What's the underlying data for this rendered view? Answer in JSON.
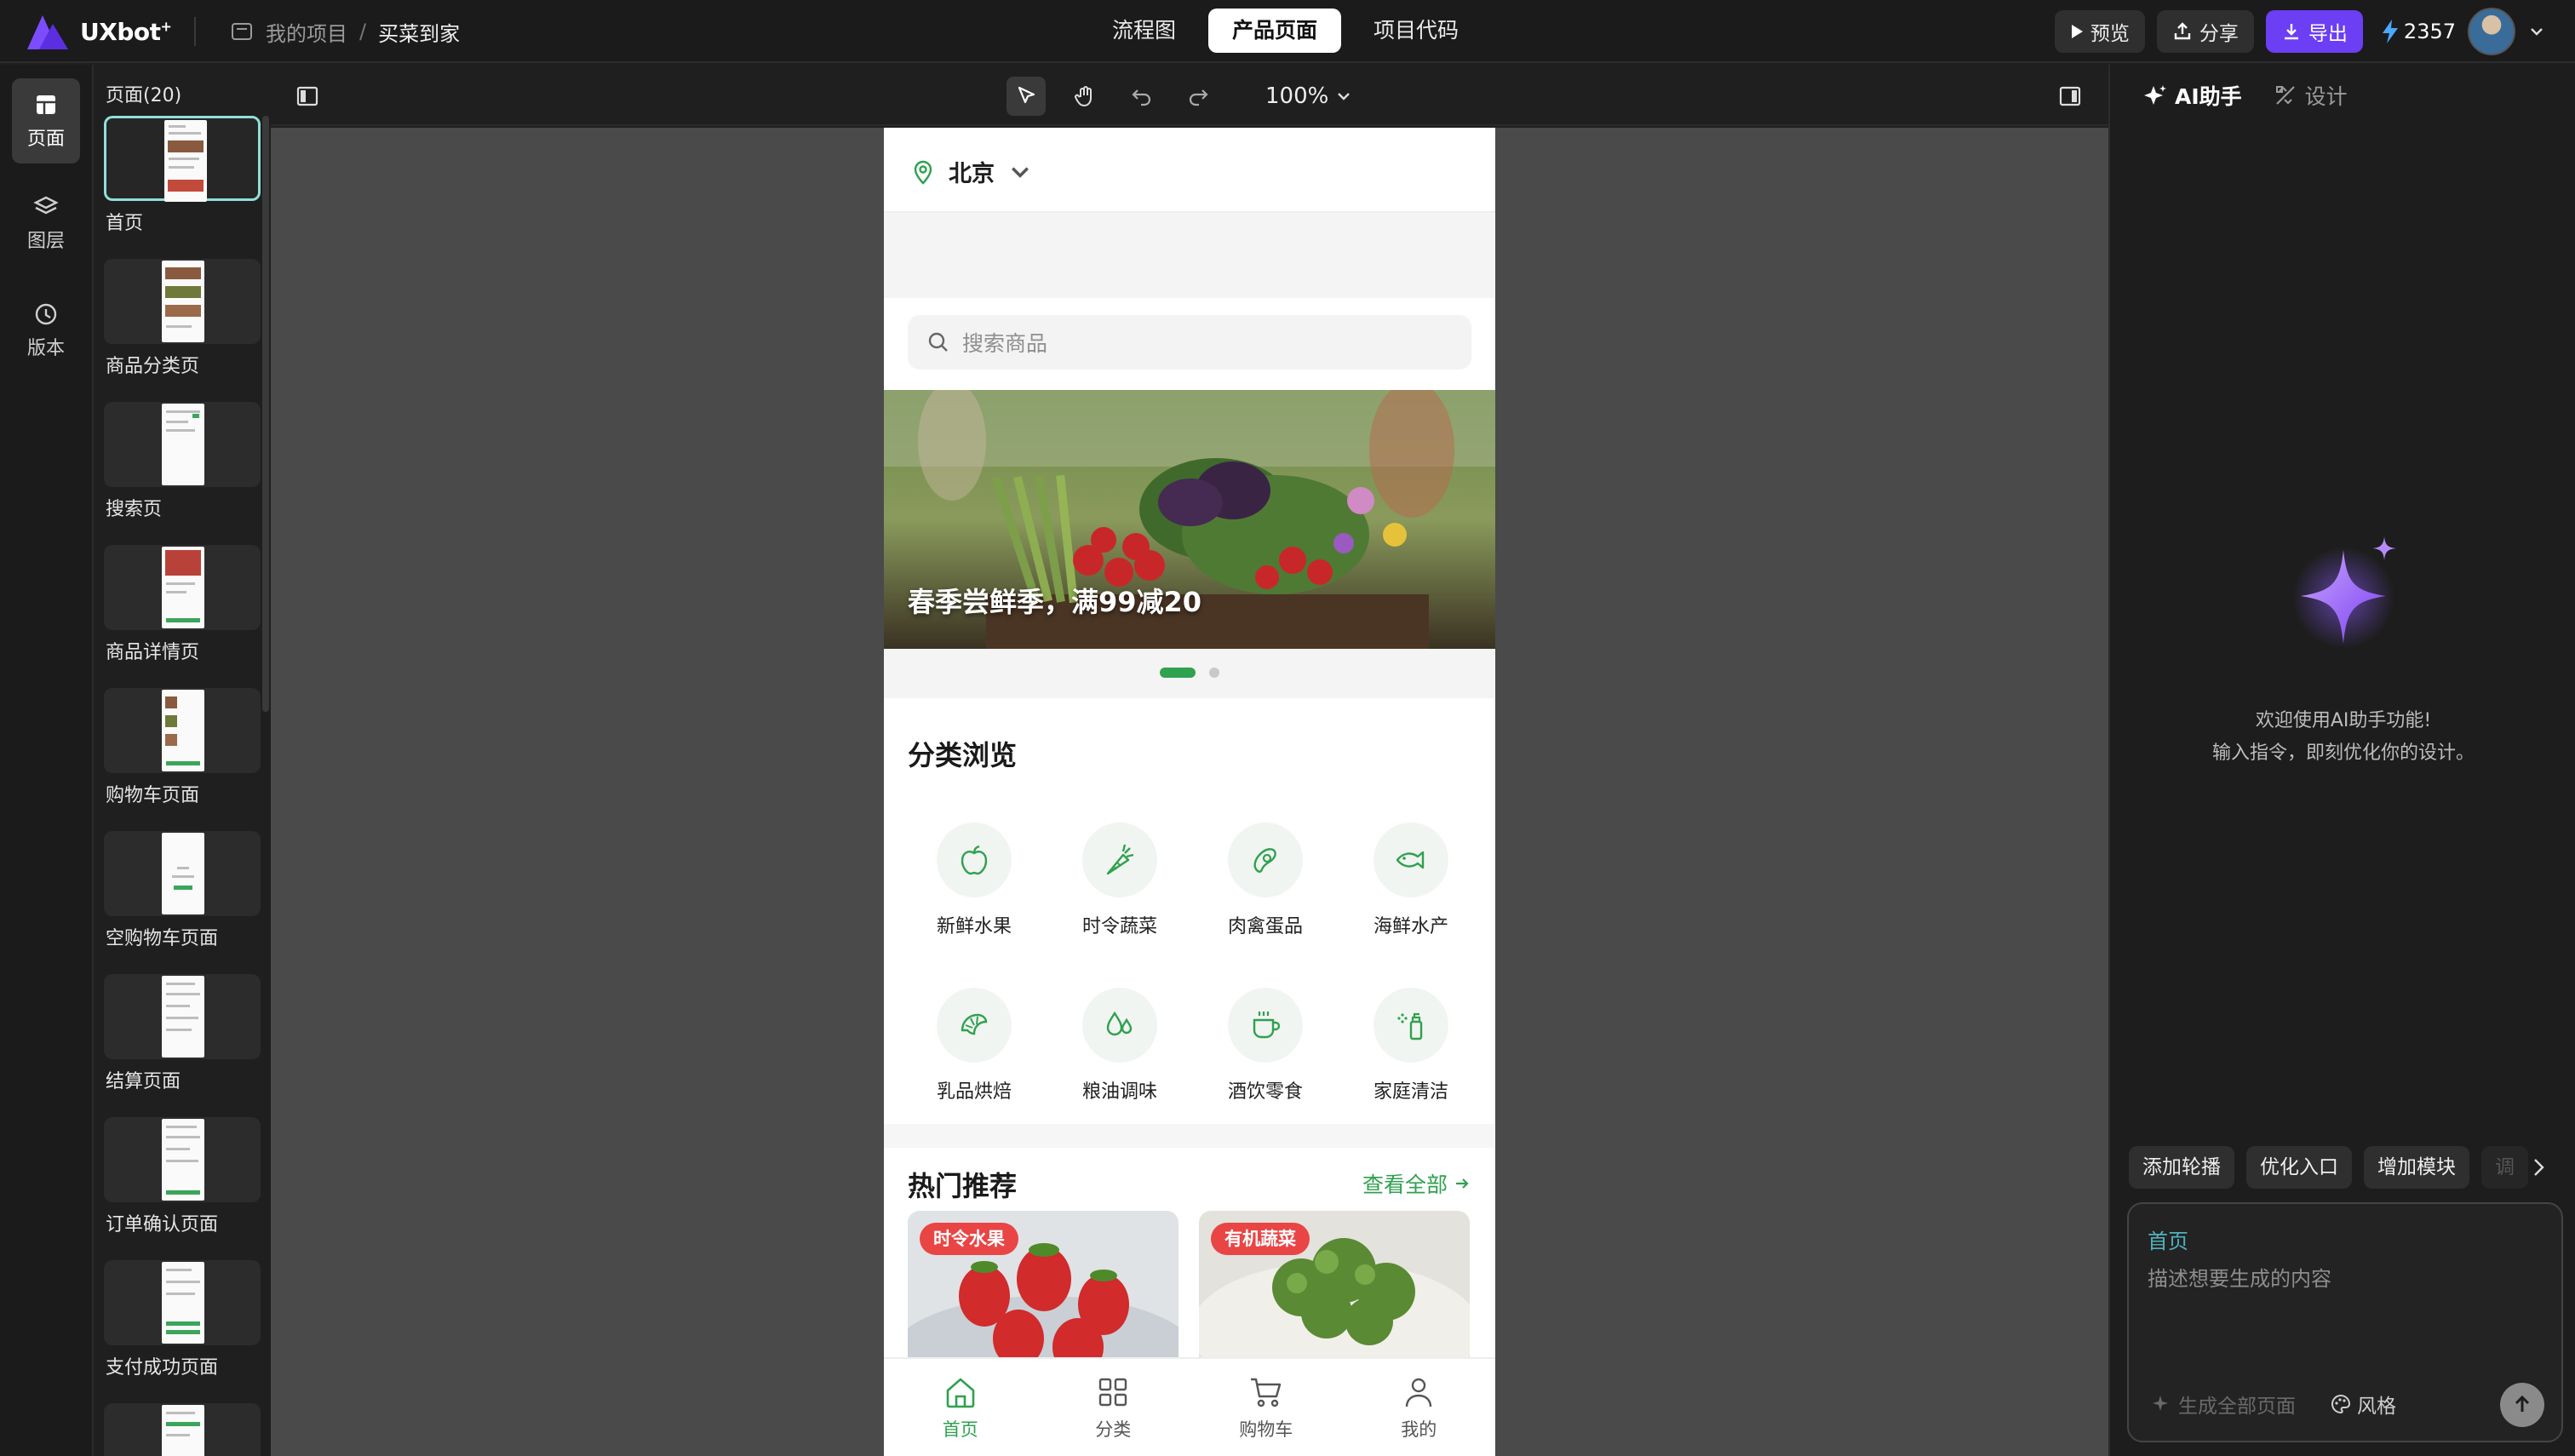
{
  "app": {
    "logo_text": "UXbot",
    "breadcrumb": {
      "project": "我的项目",
      "separator": "/",
      "page": "买菜到家"
    }
  },
  "topbar": {
    "tabs": [
      {
        "label": "流程图",
        "active": false
      },
      {
        "label": "产品页面",
        "active": true
      },
      {
        "label": "项目代码",
        "active": false
      }
    ],
    "preview_label": "预览",
    "share_label": "分享",
    "export_label": "导出",
    "credits": "2357",
    "accent_color": "#6c3ef4"
  },
  "rail": {
    "items": [
      {
        "label": "页面",
        "icon": "pages-icon",
        "active": true
      },
      {
        "label": "图层",
        "icon": "layers-icon",
        "active": false
      },
      {
        "label": "版本",
        "icon": "history-icon",
        "active": false
      }
    ]
  },
  "pages_panel": {
    "title": "页面(20)",
    "pages": [
      {
        "label": "首页",
        "active": true
      },
      {
        "label": "商品分类页",
        "active": false
      },
      {
        "label": "搜索页",
        "active": false
      },
      {
        "label": "商品详情页",
        "active": false
      },
      {
        "label": "购物车页面",
        "active": false
      },
      {
        "label": "空购物车页面",
        "active": false
      },
      {
        "label": "结算页面",
        "active": false
      },
      {
        "label": "订单确认页面",
        "active": false
      },
      {
        "label": "支付成功页面",
        "active": false
      }
    ]
  },
  "canvas_toolbar": {
    "zoom": "100%",
    "tools": [
      "select-icon",
      "hand-icon",
      "undo-icon",
      "redo-icon"
    ]
  },
  "phone": {
    "city": "北京",
    "search_placeholder": "搜索商品",
    "banner": {
      "text": "春季尝鲜季，满99减20",
      "active_index": 0,
      "count": 2
    },
    "categories_title": "分类浏览",
    "categories": [
      {
        "label": "新鲜水果",
        "icon": "apple-icon"
      },
      {
        "label": "时令蔬菜",
        "icon": "carrot-icon"
      },
      {
        "label": "肉禽蛋品",
        "icon": "meat-icon"
      },
      {
        "label": "海鲜水产",
        "icon": "fish-icon"
      },
      {
        "label": "乳品烘焙",
        "icon": "croissant-icon"
      },
      {
        "label": "粮油调味",
        "icon": "oil-drop-icon"
      },
      {
        "label": "酒饮零食",
        "icon": "cup-icon"
      },
      {
        "label": "家庭清洁",
        "icon": "spray-bottle-icon"
      }
    ],
    "hot_title": "热门推荐",
    "see_all": "查看全部",
    "products": [
      {
        "tag": "时令水果"
      },
      {
        "tag": "有机蔬菜"
      }
    ],
    "tabbar": [
      {
        "label": "首页",
        "icon": "home-icon",
        "active": true
      },
      {
        "label": "分类",
        "icon": "grid-icon",
        "active": false
      },
      {
        "label": "购物车",
        "icon": "cart-icon",
        "active": false
      },
      {
        "label": "我的",
        "icon": "user-icon",
        "active": false
      }
    ],
    "accent_color": "#2fa14f",
    "tag_color": "#e94545"
  },
  "ai_panel": {
    "tabs": [
      {
        "label": "AI助手",
        "icon": "sparkle-icon",
        "active": true
      },
      {
        "label": "设计",
        "icon": "design-icon",
        "active": false
      }
    ],
    "welcome_line1": "欢迎使用AI助手功能!",
    "welcome_line2": "输入指令，即刻优化你的设计。",
    "chips": [
      "添加轮播",
      "优化入口",
      "增加模块",
      "调"
    ],
    "prompt_context": "首页",
    "prompt_placeholder": "描述想要生成的内容",
    "generate_all_label": "生成全部页面",
    "style_label": "风格"
  }
}
